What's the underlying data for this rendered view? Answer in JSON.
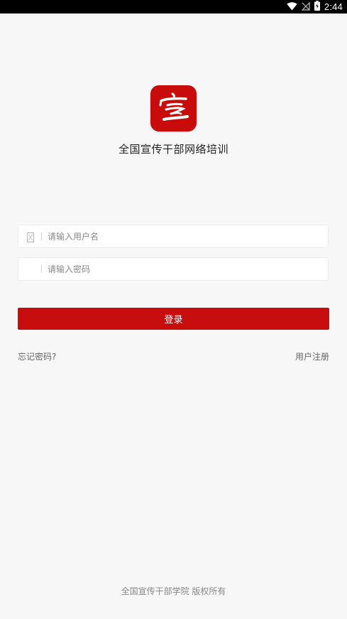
{
  "status_bar": {
    "time": "2:44",
    "icons": [
      "wifi-icon",
      "no-signal-icon",
      "battery-charging-icon"
    ]
  },
  "app": {
    "logo_icon": "xuan-calligraphy-logo",
    "title": "全国宣传干部网络培训"
  },
  "form": {
    "username_placeholder": "请输入用户名",
    "username_value": "",
    "password_placeholder": "请输入密码",
    "password_value": "",
    "login_label": "登录"
  },
  "links": {
    "forgot_password": "忘记密码?",
    "register": "用户注册"
  },
  "footer": {
    "copyright": "全国宣传干部学院 版权所有"
  },
  "colors": {
    "brand_red": "#c70d0d",
    "background": "#f7f7f7"
  }
}
